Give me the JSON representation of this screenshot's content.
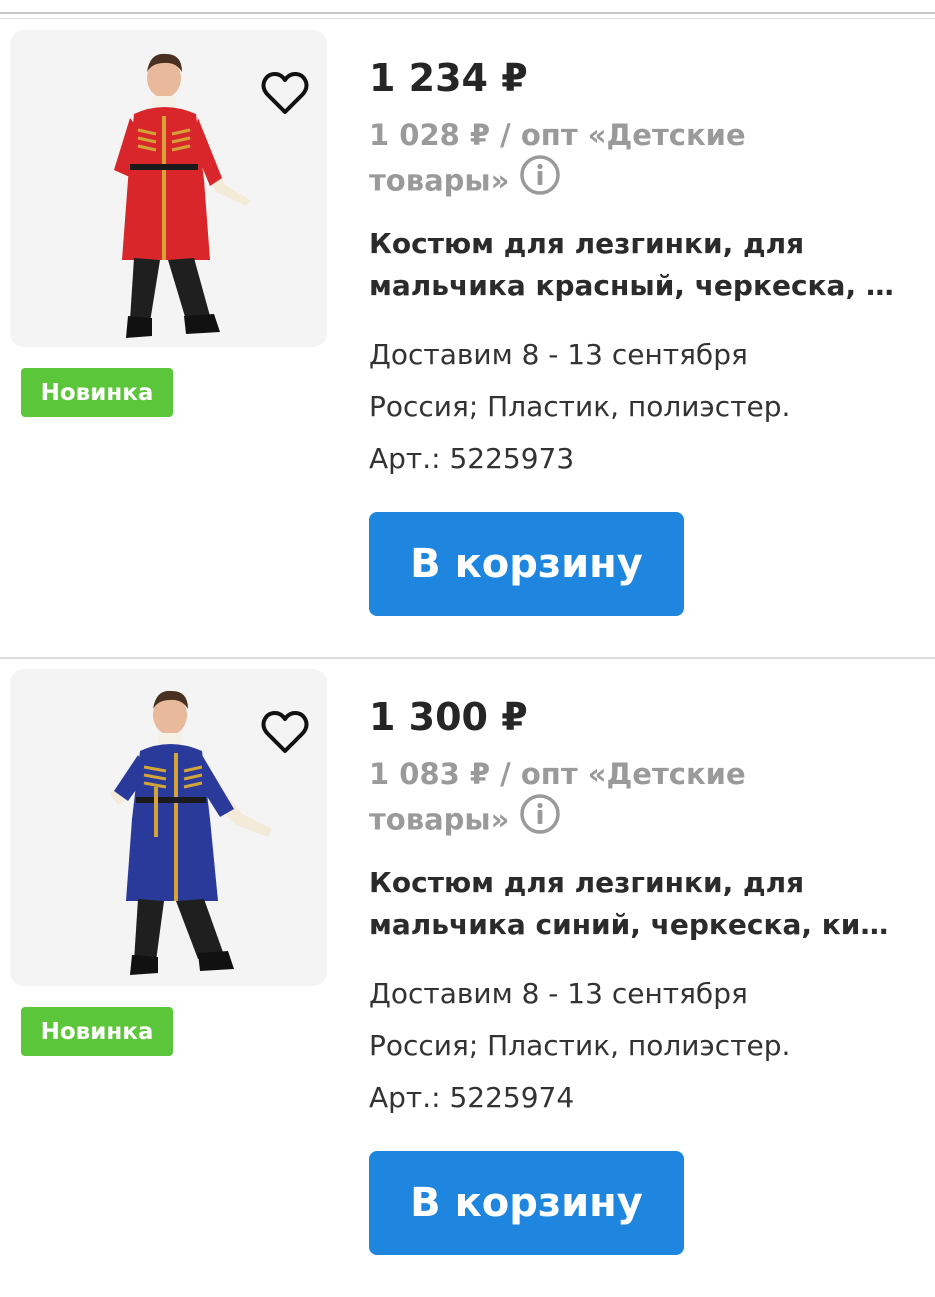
{
  "products": [
    {
      "price": "1 234 ₽",
      "wholesale_line1": "1 028 ₽ / опт «Детские",
      "wholesale_line2": "товары»",
      "title_line1": "Костюм для лезгинки, для",
      "title_line2": "мальчика красный, черкеска, к...",
      "delivery": "Доставим 8 - 13 сентября",
      "material": "Россия; Пластик, полиэстер.",
      "article": "Арт.: 5225973",
      "badge": "Новинка",
      "cart_label": "В корзину",
      "coat_color": "#d8262a",
      "icons": {
        "favorite": "heart-outline-icon",
        "info": "info-circle-icon"
      }
    },
    {
      "price": "1 300 ₽",
      "wholesale_line1": "1 083 ₽ / опт «Детские",
      "wholesale_line2": "товары»",
      "title_line1": "Костюм для лезгинки, для",
      "title_line2": "мальчика синий, черкеска, кин...",
      "delivery": "Доставим 8 - 13 сентября",
      "material": "Россия; Пластик, полиэстер.",
      "article": "Арт.: 5225974",
      "badge": "Новинка",
      "cart_label": "В корзину",
      "coat_color": "#2a3a9a",
      "icons": {
        "favorite": "heart-outline-icon",
        "info": "info-circle-icon"
      }
    }
  ],
  "colors": {
    "accent_button": "#1f86e0",
    "badge_green": "#5cc63a",
    "muted_text": "#9a9a9a"
  }
}
